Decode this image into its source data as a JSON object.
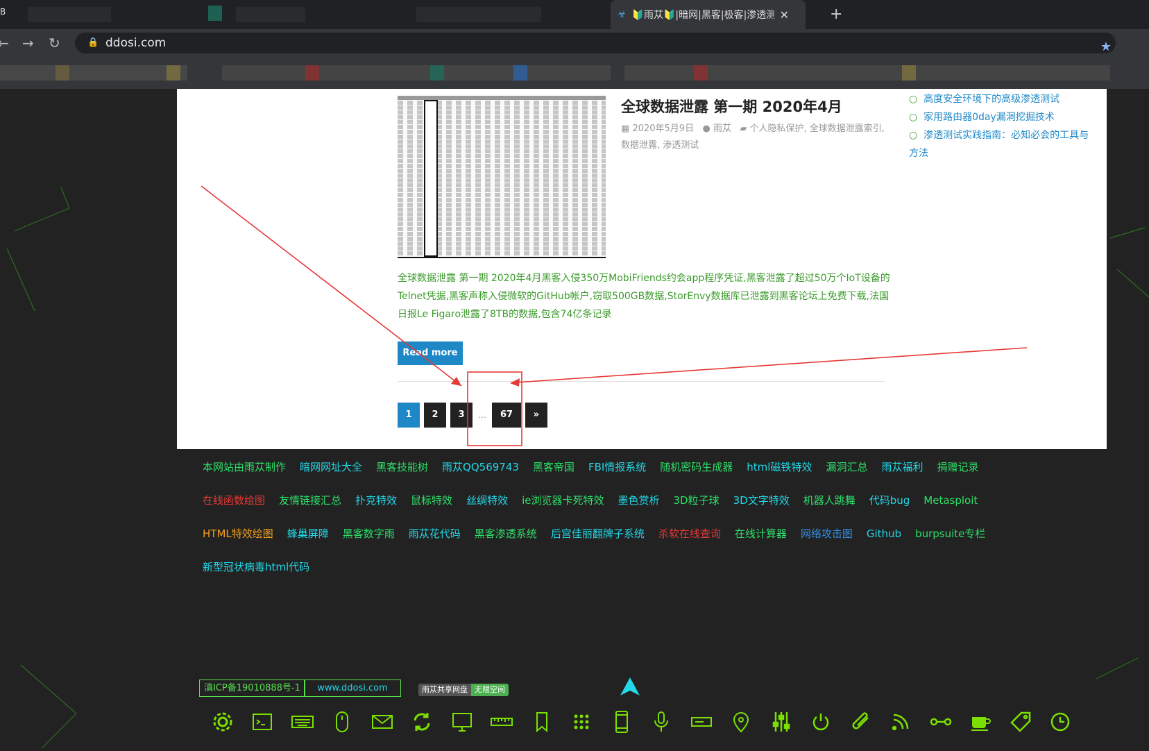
{
  "browser": {
    "tab_left_label": "B",
    "active_tab_title": "🔰雨苁🔰|暗网|黑客|极客|渗透测",
    "close_glyph": "✕",
    "new_tab_glyph": "+",
    "url": "ddosi.com",
    "colors": {
      "tabbar": "#202124",
      "toolbar": "#35363a"
    }
  },
  "post": {
    "title": "全球数据泄露 第一期 2020年4月",
    "date": "2020年5月9日",
    "author": "雨苁",
    "categories": "个人隐私保护, 全球数据泄露索引, 数据泄露, 渗透测试",
    "excerpt": "全球数据泄露 第一期 2020年4月黑客入侵350万MobiFriends约会app程序凭证,黑客泄露了超过50万个IoT设备的Telnet凭据,黑客声称入侵微软的GitHub帐户,窃取500GB数据,StorEnvy数据库已泄露到黑客论坛上免费下载,法国日报Le Figaro泄露了8TB的数据,包含74亿条记录",
    "read_more": "Read more"
  },
  "pagination": {
    "p1": "1",
    "p2": "2",
    "p3": "3",
    "dots": "…",
    "last": "67",
    "next": "»"
  },
  "sidebar": {
    "item1": "高度安全环境下的高级渗透测试",
    "item2": "家用路由器0day漏洞挖掘技术",
    "item3": "渗透测试实践指南：必知必会的工具与方法"
  },
  "footer": {
    "row1": [
      {
        "text": "本网站由雨苁制作",
        "color": "#2ee06a"
      },
      {
        "text": "暗网网址大全",
        "color": "#23d8e8"
      },
      {
        "text": "黑客技能树",
        "color": "#2ee06a"
      },
      {
        "text": "雨苁QQ569743",
        "color": "#23d8e8"
      },
      {
        "text": "黑客帝国",
        "color": "#2ee06a"
      },
      {
        "text": "FBI情报系统",
        "color": "#23d8e8"
      },
      {
        "text": "随机密码生成器",
        "color": "#2ee06a"
      },
      {
        "text": "html磁铁特效",
        "color": "#23d8e8"
      },
      {
        "text": "漏洞汇总",
        "color": "#2ee06a"
      },
      {
        "text": "雨苁福利",
        "color": "#23d8e8"
      },
      {
        "text": "捐赠记录",
        "color": "#2ee06a"
      }
    ],
    "row2": [
      {
        "text": "在线函数绘图",
        "color": "#e53935"
      },
      {
        "text": "友情链接汇总",
        "color": "#2ee06a"
      },
      {
        "text": "扑克特效",
        "color": "#23d8e8"
      },
      {
        "text": "鼠标特效",
        "color": "#2ee06a"
      },
      {
        "text": "丝绸特效",
        "color": "#23d8e8"
      },
      {
        "text": "ie浏览器卡死特效",
        "color": "#2ee06a"
      },
      {
        "text": "墨色赏析",
        "color": "#23d8e8"
      },
      {
        "text": "3D粒子球",
        "color": "#2ee06a"
      },
      {
        "text": "3D文字特效",
        "color": "#23d8e8"
      },
      {
        "text": "机器人跳舞",
        "color": "#2ee06a"
      },
      {
        "text": "代码bug",
        "color": "#23d8e8"
      },
      {
        "text": "Metasploit",
        "color": "#2ee06a"
      }
    ],
    "row3": [
      {
        "text": "HTML特效绘图",
        "color": "#f4a020"
      },
      {
        "text": "蜂巢屏障",
        "color": "#23d8e8"
      },
      {
        "text": "黑客数字雨",
        "color": "#2ee06a"
      },
      {
        "text": "雨苁花代码",
        "color": "#23d8e8"
      },
      {
        "text": "黑客渗透系统",
        "color": "#2ee06a"
      },
      {
        "text": "后宫佳丽翻牌子系统",
        "color": "#23d8e8"
      },
      {
        "text": "杀软在线查询",
        "color": "#e53935"
      },
      {
        "text": "在线计算器",
        "color": "#2ee06a"
      },
      {
        "text": "网络攻击图",
        "color": "#2f8fe8"
      },
      {
        "text": "Github",
        "color": "#23d8e8"
      },
      {
        "text": "burpsuite专栏",
        "color": "#2ee06a"
      }
    ],
    "row4": [
      {
        "text": "新型冠状病毒html代码",
        "color": "#23d8e8"
      }
    ],
    "icp": "滇ICP备19010888号-1",
    "domain": "www.ddosi.com",
    "netdisk_left": "雨苁共享网盘",
    "netdisk_right": "无限空间",
    "icons": [
      "gear-icon",
      "terminal-icon",
      "keyboard-icon",
      "mouse-icon",
      "mail-icon",
      "refresh-icon",
      "monitor-icon",
      "ruler-icon",
      "bookmark-icon",
      "grid-dots-icon",
      "phone-icon",
      "microphone-icon",
      "projector-icon",
      "location-pin-icon",
      "sliders-icon",
      "power-icon",
      "paperclip-icon",
      "rss-icon",
      "link-icon",
      "coffee-icon",
      "tag-icon",
      "clock-icon"
    ],
    "icon_color": "#7be000"
  }
}
